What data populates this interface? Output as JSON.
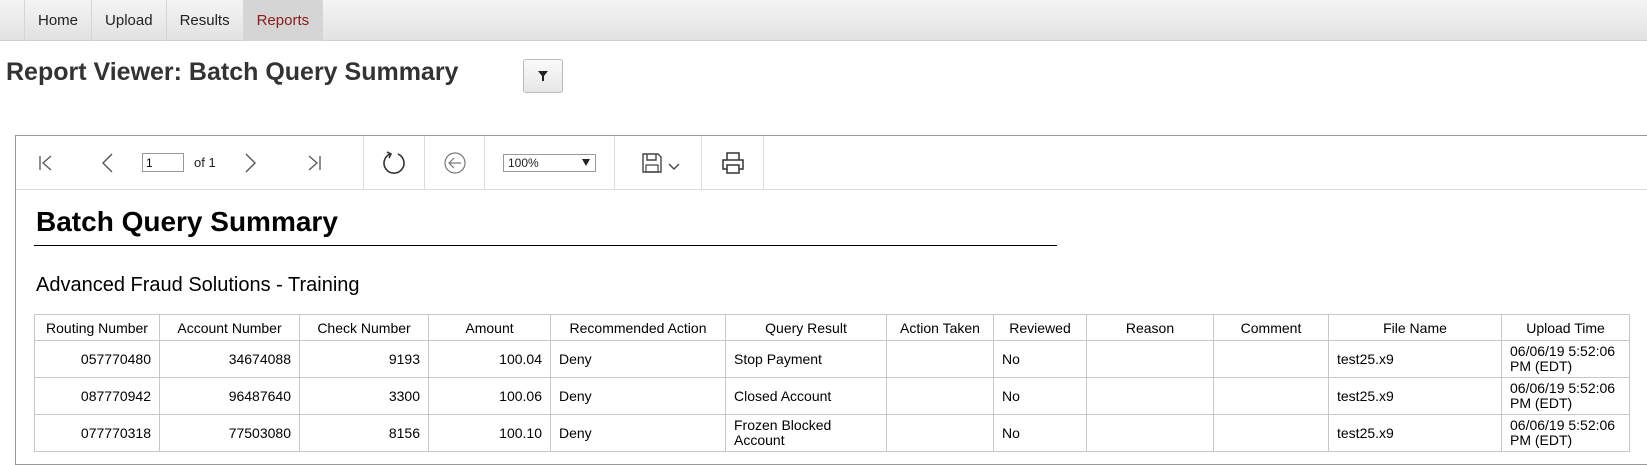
{
  "nav": {
    "tabs": [
      {
        "label": "Home"
      },
      {
        "label": "Upload"
      },
      {
        "label": "Results"
      },
      {
        "label": "Reports"
      }
    ],
    "active": "Reports"
  },
  "header": {
    "title": "Report Viewer: Batch Query Summary",
    "filter_icon": "filter-icon"
  },
  "toolbar": {
    "page_value": "1",
    "page_of": "of 1",
    "zoom_value": "100%",
    "icons": [
      "first-page-icon",
      "previous-page-icon",
      "next-page-icon",
      "last-page-icon",
      "refresh-icon",
      "back-icon",
      "save-icon",
      "chevron-down-icon",
      "print-icon"
    ]
  },
  "report": {
    "title": "Batch Query Summary",
    "subtitle": "Advanced Fraud Solutions - Training",
    "columns": [
      "Routing Number",
      "Account Number",
      "Check Number",
      "Amount",
      "Recommended Action",
      "Query Result",
      "Action Taken",
      "Reviewed",
      "Reason",
      "Comment",
      "File Name",
      "Upload Time"
    ],
    "rows": [
      [
        "057770480",
        "34674088",
        "9193",
        "100.04",
        "Deny",
        "Stop Payment",
        "",
        "No",
        "",
        "",
        "test25.x9",
        "06/06/19  5:52:06 PM (EDT)"
      ],
      [
        "087770942",
        "96487640",
        "3300",
        "100.06",
        "Deny",
        "Closed Account",
        "",
        "No",
        "",
        "",
        "test25.x9",
        "06/06/19  5:52:06 PM (EDT)"
      ],
      [
        "077770318",
        "77503080",
        "8156",
        "100.10",
        "Deny",
        "Frozen Blocked Account",
        "",
        "No",
        "",
        "",
        "test25.x9",
        "06/06/19  5:52:06 PM (EDT)"
      ]
    ]
  }
}
